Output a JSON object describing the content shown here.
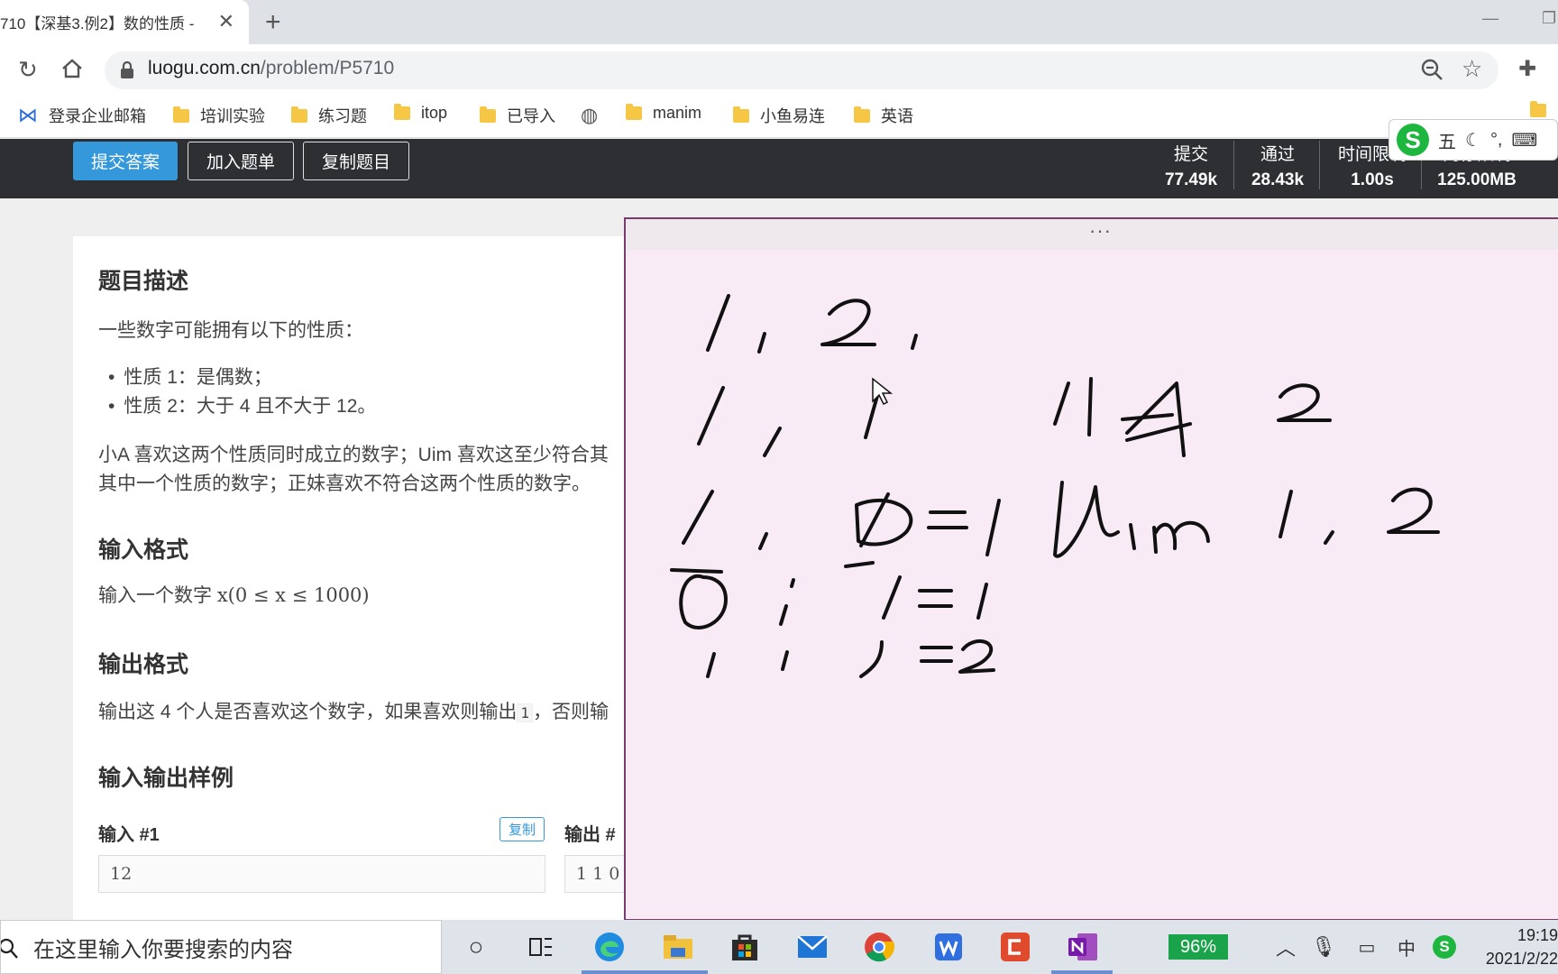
{
  "browser": {
    "tab_title": "710【深基3.例2】数的性质 -",
    "url_host": "luogu.com.cn",
    "url_path": "/problem/P5710",
    "bookmarks": [
      "登录企业邮箱",
      "培训实验",
      "练习题",
      "itop",
      "已导入",
      "manim",
      "小鱼易连",
      "英语"
    ]
  },
  "ime": {
    "s": "S",
    "mode": "五"
  },
  "problem_header": {
    "buttons": [
      "提交答案",
      "加入题单",
      "复制题目"
    ],
    "stats": [
      {
        "label": "提交",
        "value": "77.49k"
      },
      {
        "label": "通过",
        "value": "28.43k"
      },
      {
        "label": "时间限制",
        "value": "1.00s"
      },
      {
        "label": "内存限制",
        "value": "125.00MB"
      }
    ]
  },
  "problem": {
    "desc_title": "题目描述",
    "desc_intro": "一些数字可能拥有以下的性质：",
    "props": [
      "性质 1：是偶数；",
      "性质 2：大于 4 且不大于 12。"
    ],
    "desc_line1": "小A 喜欢这两个性质同时成立的数字；Uim 喜欢这至少符合其",
    "desc_line2": "其中一个性质的数字；正妹喜欢不符合这两个性质的数字。",
    "input_title": "输入格式",
    "input_text": "输入一个数字",
    "input_math": "x(0 ≤ x ≤ 1000)",
    "output_title": "输出格式",
    "output_text_a": "输出这 4 个人是否喜欢这个数字，如果喜欢则输出",
    "output_code": "1",
    "output_text_b": "，否则输",
    "samples_title": "输入输出样例",
    "input1_label": "输入 #1",
    "copy_label": "复制",
    "input1_value": "12",
    "output1_label": "输出 #",
    "output1_value": "1 1 0"
  },
  "onenote": {
    "handle": "···"
  },
  "taskbar": {
    "search_placeholder": "在这里输入你要搜索的内容",
    "battery": "96%",
    "time": "19:19",
    "date": "2021/2/22"
  }
}
